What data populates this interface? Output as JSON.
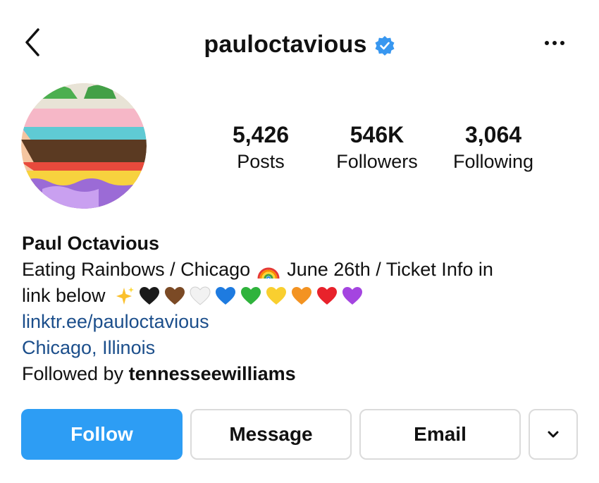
{
  "header": {
    "username": "pauloctavious",
    "back_icon": "chevron-left-icon",
    "verified_icon": "verified-badge-icon",
    "more_icon": "more-horizontal-icon",
    "verified_color": "#3897f0"
  },
  "profile": {
    "avatar_icon": "profile-avatar",
    "stats": [
      {
        "value": "5,426",
        "label": "Posts"
      },
      {
        "value": "546K",
        "label": "Followers"
      },
      {
        "value": "3,064",
        "label": "Following"
      }
    ]
  },
  "bio": {
    "name": "Paul Octavious",
    "line1_a": "Eating Rainbows / Chicago",
    "line1_b": "June 26th / Ticket Info in",
    "line2": "link below",
    "link": "linktr.ee/pauloctavious",
    "location": "Chicago, Illinois",
    "followed_by_prefix": "Followed by ",
    "followed_by_user": "tennesseewilliams",
    "emojis": [
      "rainbow",
      "sparkles",
      "black-heart",
      "brown-heart",
      "white-heart",
      "blue-heart",
      "green-heart",
      "yellow-heart",
      "orange-heart",
      "red-heart",
      "purple-heart"
    ],
    "link_color": "#1b4e8b"
  },
  "actions": {
    "follow": "Follow",
    "message": "Message",
    "email": "Email",
    "more_icon": "chevron-down-icon",
    "follow_color": "#2d9df4"
  }
}
